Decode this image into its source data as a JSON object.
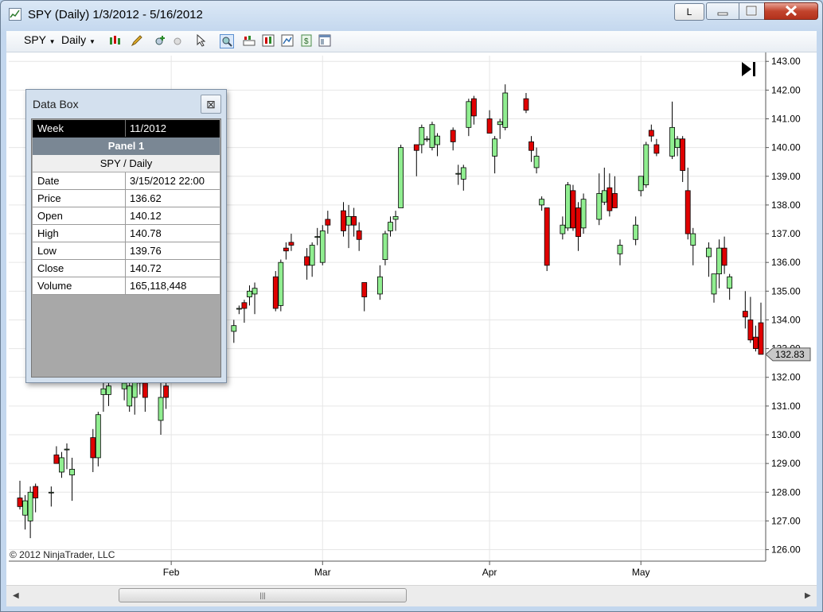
{
  "window": {
    "title": "SPY (Daily)  1/3/2012 - 5/16/2012",
    "layout_button_label": "L"
  },
  "toolbar": {
    "instrument_label": "SPY",
    "interval_label": "Daily"
  },
  "copyright": "© 2012 NinjaTrader, LLC",
  "current_price_label": "132.83",
  "data_box": {
    "title": "Data Box",
    "week_label": "Week",
    "week_value": "11/2012",
    "panel_label": "Panel 1",
    "instrument_label": "SPY / Daily",
    "rows": [
      {
        "label": "Date",
        "value": "3/15/2012 22:00"
      },
      {
        "label": "Price",
        "value": "136.62"
      },
      {
        "label": "Open",
        "value": "140.12"
      },
      {
        "label": "High",
        "value": "140.78"
      },
      {
        "label": "Low",
        "value": "139.76"
      },
      {
        "label": "Close",
        "value": "140.72"
      },
      {
        "label": "Volume",
        "value": "165,118,448"
      }
    ]
  },
  "colors": {
    "up_fill": "#90ee90",
    "down_fill": "#e00000",
    "wick": "#000000",
    "grid": "#e6e6e6",
    "price_marker_bg": "#c8c8c8"
  },
  "chart_data": {
    "type": "candlestick",
    "ylim": [
      125.6,
      143.2
    ],
    "y_ticks": [
      "143.00",
      "142.00",
      "141.00",
      "140.00",
      "139.00",
      "138.00",
      "137.00",
      "136.00",
      "135.00",
      "134.00",
      "133.00",
      "132.00",
      "131.00",
      "130.00",
      "129.00",
      "128.00",
      "127.00",
      "126.00"
    ],
    "x_ticks": [
      "Feb",
      "Mar",
      "Apr",
      "May"
    ],
    "x_tick_dates": [
      "2012-02-01",
      "2012-03-01",
      "2012-04-02",
      "2012-05-01"
    ],
    "bars": [
      {
        "date": "2012-01-03",
        "open": 127.8,
        "high": 128.4,
        "low": 127.4,
        "close": 127.5
      },
      {
        "date": "2012-01-04",
        "open": 127.2,
        "high": 127.9,
        "low": 126.7,
        "close": 127.7
      },
      {
        "date": "2012-01-05",
        "open": 127.0,
        "high": 128.2,
        "low": 126.4,
        "close": 128.0
      },
      {
        "date": "2012-01-06",
        "open": 128.2,
        "high": 128.3,
        "low": 127.3,
        "close": 127.8
      },
      {
        "date": "2012-01-09",
        "open": 128.0,
        "high": 128.2,
        "low": 127.5,
        "close": 128.0
      },
      {
        "date": "2012-01-10",
        "open": 129.3,
        "high": 129.6,
        "low": 129.0,
        "close": 129.0
      },
      {
        "date": "2012-01-11",
        "open": 128.7,
        "high": 129.4,
        "low": 128.5,
        "close": 129.2
      },
      {
        "date": "2012-01-12",
        "open": 129.5,
        "high": 129.7,
        "low": 128.8,
        "close": 129.5
      },
      {
        "date": "2012-01-13",
        "open": 128.6,
        "high": 129.2,
        "low": 127.7,
        "close": 128.8
      },
      {
        "date": "2012-01-17",
        "open": 129.9,
        "high": 130.2,
        "low": 128.7,
        "close": 129.2
      },
      {
        "date": "2012-01-18",
        "open": 129.2,
        "high": 130.8,
        "low": 128.9,
        "close": 130.7
      },
      {
        "date": "2012-01-19",
        "open": 131.4,
        "high": 131.8,
        "low": 130.8,
        "close": 131.6
      },
      {
        "date": "2012-01-20",
        "open": 131.4,
        "high": 132.2,
        "low": 131.0,
        "close": 131.7
      },
      {
        "date": "2012-01-23",
        "open": 131.6,
        "high": 132.1,
        "low": 131.2,
        "close": 131.8
      },
      {
        "date": "2012-01-24",
        "open": 131.0,
        "high": 132.0,
        "low": 130.8,
        "close": 131.7
      },
      {
        "date": "2012-01-25",
        "open": 131.3,
        "high": 132.0,
        "low": 130.7,
        "close": 132.0
      },
      {
        "date": "2012-01-26",
        "open": 132.4,
        "high": 133.0,
        "low": 131.4,
        "close": 131.8
      },
      {
        "date": "2012-01-27",
        "open": 131.8,
        "high": 132.1,
        "low": 130.8,
        "close": 131.3
      },
      {
        "date": "2012-01-30",
        "open": 130.5,
        "high": 131.8,
        "low": 130.0,
        "close": 131.3
      },
      {
        "date": "2012-01-31",
        "open": 131.7,
        "high": 132.0,
        "low": 130.9,
        "close": 131.3
      },
      {
        "date": "2012-02-13",
        "open": 133.6,
        "high": 134.0,
        "low": 133.2,
        "close": 133.8
      },
      {
        "date": "2012-02-14",
        "open": 134.4,
        "high": 134.5,
        "low": 134.2,
        "close": 134.4
      },
      {
        "date": "2012-02-15",
        "open": 134.6,
        "high": 134.7,
        "low": 133.9,
        "close": 134.4
      },
      {
        "date": "2012-02-16",
        "open": 134.8,
        "high": 135.2,
        "low": 134.5,
        "close": 135.0
      },
      {
        "date": "2012-02-17",
        "open": 134.9,
        "high": 135.3,
        "low": 134.2,
        "close": 135.1
      },
      {
        "date": "2012-02-21",
        "open": 135.5,
        "high": 135.7,
        "low": 134.3,
        "close": 134.4
      },
      {
        "date": "2012-02-22",
        "open": 134.5,
        "high": 136.1,
        "low": 134.3,
        "close": 136.0
      },
      {
        "date": "2012-02-23",
        "open": 136.5,
        "high": 136.7,
        "low": 136.1,
        "close": 136.4
      },
      {
        "date": "2012-02-24",
        "open": 136.7,
        "high": 137.0,
        "low": 136.4,
        "close": 136.6
      },
      {
        "date": "2012-02-27",
        "open": 136.2,
        "high": 136.5,
        "low": 135.4,
        "close": 135.9
      },
      {
        "date": "2012-02-28",
        "open": 135.9,
        "high": 136.7,
        "low": 135.5,
        "close": 136.6
      },
      {
        "date": "2012-02-29",
        "open": 136.9,
        "high": 137.2,
        "low": 136.6,
        "close": 136.9
      },
      {
        "date": "2012-03-01",
        "open": 136.0,
        "high": 137.3,
        "low": 135.9,
        "close": 137.1
      },
      {
        "date": "2012-03-02",
        "open": 137.5,
        "high": 137.8,
        "low": 137.0,
        "close": 137.3
      },
      {
        "date": "2012-03-05",
        "open": 137.8,
        "high": 138.1,
        "low": 136.9,
        "close": 137.1
      },
      {
        "date": "2012-03-06",
        "open": 137.3,
        "high": 138.0,
        "low": 136.5,
        "close": 137.6
      },
      {
        "date": "2012-03-07",
        "open": 137.6,
        "high": 137.9,
        "low": 136.9,
        "close": 137.3
      },
      {
        "date": "2012-03-08",
        "open": 137.1,
        "high": 137.4,
        "low": 136.4,
        "close": 136.8
      },
      {
        "date": "2012-03-09",
        "open": 135.3,
        "high": 135.3,
        "low": 134.3,
        "close": 134.8
      },
      {
        "date": "2012-03-12",
        "open": 134.9,
        "high": 135.9,
        "low": 134.7,
        "close": 135.5
      },
      {
        "date": "2012-03-13",
        "open": 136.1,
        "high": 137.1,
        "low": 135.9,
        "close": 137.0
      },
      {
        "date": "2012-03-14",
        "open": 137.1,
        "high": 137.6,
        "low": 136.9,
        "close": 137.4
      },
      {
        "date": "2012-03-15",
        "open": 137.5,
        "high": 137.8,
        "low": 137.1,
        "close": 137.6
      },
      {
        "date": "2012-03-16",
        "open": 137.9,
        "high": 140.1,
        "low": 137.9,
        "close": 140.0
      },
      {
        "date": "2012-03-19",
        "open": 140.1,
        "high": 140.1,
        "low": 139.0,
        "close": 139.9
      },
      {
        "date": "2012-03-20",
        "open": 140.1,
        "high": 140.8,
        "low": 139.8,
        "close": 140.7
      },
      {
        "date": "2012-03-21",
        "open": 140.3,
        "high": 140.4,
        "low": 140.2,
        "close": 140.3
      },
      {
        "date": "2012-03-22",
        "open": 140.0,
        "high": 140.9,
        "low": 139.9,
        "close": 140.8
      },
      {
        "date": "2012-03-23",
        "open": 140.1,
        "high": 140.5,
        "low": 139.7,
        "close": 140.4
      },
      {
        "date": "2012-03-26",
        "open": 140.6,
        "high": 140.7,
        "low": 139.9,
        "close": 140.2
      },
      {
        "date": "2012-03-27",
        "open": 139.1,
        "high": 139.4,
        "low": 138.7,
        "close": 139.1
      },
      {
        "date": "2012-03-28",
        "open": 138.9,
        "high": 139.4,
        "low": 138.5,
        "close": 139.3
      },
      {
        "date": "2012-03-29",
        "open": 140.7,
        "high": 141.7,
        "low": 140.4,
        "close": 141.6
      },
      {
        "date": "2012-03-30",
        "open": 141.7,
        "high": 141.8,
        "low": 140.8,
        "close": 141.1
      },
      {
        "date": "2012-04-02",
        "open": 141.0,
        "high": 141.3,
        "low": 140.5,
        "close": 140.5
      },
      {
        "date": "2012-04-03",
        "open": 139.7,
        "high": 140.4,
        "low": 139.1,
        "close": 140.3
      },
      {
        "date": "2012-04-04",
        "open": 140.8,
        "high": 141.0,
        "low": 140.3,
        "close": 140.9
      },
      {
        "date": "2012-04-05",
        "open": 140.7,
        "high": 142.2,
        "low": 140.6,
        "close": 141.9
      },
      {
        "date": "2012-04-09",
        "open": 141.7,
        "high": 141.9,
        "low": 141.2,
        "close": 141.3
      },
      {
        "date": "2012-04-10",
        "open": 140.2,
        "high": 140.4,
        "low": 139.5,
        "close": 139.9
      },
      {
        "date": "2012-04-11",
        "open": 139.3,
        "high": 140.0,
        "low": 139.1,
        "close": 139.7
      },
      {
        "date": "2012-04-12",
        "open": 138.0,
        "high": 138.3,
        "low": 137.8,
        "close": 138.2
      },
      {
        "date": "2012-04-13",
        "open": 137.9,
        "high": 137.9,
        "low": 135.7,
        "close": 135.9
      },
      {
        "date": "2012-04-16",
        "open": 137.0,
        "high": 137.6,
        "low": 136.8,
        "close": 137.3
      },
      {
        "date": "2012-04-17",
        "open": 137.2,
        "high": 138.8,
        "low": 137.1,
        "close": 138.7
      },
      {
        "date": "2012-04-18",
        "open": 138.5,
        "high": 138.7,
        "low": 137.1,
        "close": 137.2
      },
      {
        "date": "2012-04-19",
        "open": 137.9,
        "high": 138.1,
        "low": 136.4,
        "close": 136.9
      },
      {
        "date": "2012-04-20",
        "open": 137.2,
        "high": 138.4,
        "low": 137.0,
        "close": 138.2
      },
      {
        "date": "2012-04-23",
        "open": 137.5,
        "high": 139.1,
        "low": 137.3,
        "close": 138.4
      },
      {
        "date": "2012-04-24",
        "open": 138.1,
        "high": 139.3,
        "low": 138.0,
        "close": 138.5
      },
      {
        "date": "2012-04-25",
        "open": 138.6,
        "high": 139.1,
        "low": 137.6,
        "close": 137.8
      },
      {
        "date": "2012-04-26",
        "open": 138.4,
        "high": 139.0,
        "low": 137.9,
        "close": 137.9
      },
      {
        "date": "2012-04-27",
        "open": 136.3,
        "high": 136.8,
        "low": 135.9,
        "close": 136.6
      },
      {
        "date": "2012-04-30",
        "open": 136.8,
        "high": 137.6,
        "low": 136.6,
        "close": 137.3
      },
      {
        "date": "2012-05-01",
        "open": 138.5,
        "high": 139.0,
        "low": 138.3,
        "close": 139.0
      },
      {
        "date": "2012-05-02",
        "open": 138.7,
        "high": 140.2,
        "low": 138.6,
        "close": 140.1
      },
      {
        "date": "2012-05-03",
        "open": 140.6,
        "high": 140.8,
        "low": 140.2,
        "close": 140.4
      },
      {
        "date": "2012-05-04",
        "open": 140.1,
        "high": 140.3,
        "low": 139.7,
        "close": 139.8
      },
      {
        "date": "2012-05-07",
        "open": 139.7,
        "high": 141.6,
        "low": 139.6,
        "close": 140.7
      },
      {
        "date": "2012-05-08",
        "open": 140.0,
        "high": 140.4,
        "low": 139.7,
        "close": 140.3
      },
      {
        "date": "2012-05-09",
        "open": 140.3,
        "high": 140.4,
        "low": 138.8,
        "close": 139.2
      },
      {
        "date": "2012-05-10",
        "open": 138.5,
        "high": 139.3,
        "low": 136.8,
        "close": 137.0
      },
      {
        "date": "2012-05-11",
        "open": 136.6,
        "high": 137.2,
        "low": 135.9,
        "close": 137.0
      },
      {
        "date": "2012-05-14",
        "open": 136.2,
        "high": 136.7,
        "low": 135.5,
        "close": 136.5
      },
      {
        "date": "2012-05-15",
        "open": 134.9,
        "high": 135.6,
        "low": 134.6,
        "close": 135.6
      },
      {
        "date": "2012-05-16",
        "open": 135.6,
        "high": 136.8,
        "low": 135.1,
        "close": 136.5
      },
      {
        "date": "2012-05-17",
        "open": 136.5,
        "high": 136.9,
        "low": 135.6,
        "close": 135.9
      },
      {
        "date": "2012-05-18",
        "open": 135.1,
        "high": 135.6,
        "low": 134.7,
        "close": 135.5
      },
      {
        "date": "2012-05-21",
        "open": 134.3,
        "high": 135.0,
        "low": 133.7,
        "close": 134.1
      },
      {
        "date": "2012-05-22",
        "open": 134.0,
        "high": 134.8,
        "low": 133.2,
        "close": 133.3
      },
      {
        "date": "2012-05-23",
        "open": 133.4,
        "high": 133.8,
        "low": 132.9,
        "close": 133.0
      },
      {
        "date": "2012-05-24",
        "open": 133.9,
        "high": 134.6,
        "low": 132.8,
        "close": 132.8
      }
    ]
  }
}
